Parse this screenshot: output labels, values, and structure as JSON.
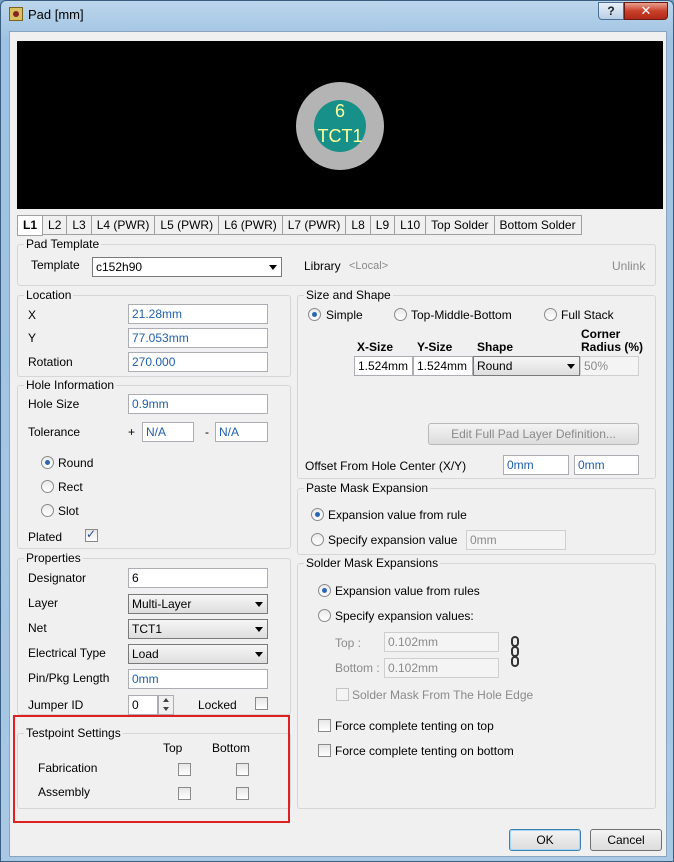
{
  "window": {
    "title": "Pad [mm]",
    "help": "?",
    "close": "✕"
  },
  "preview": {
    "pad_number": "6",
    "pad_net": "TCT1"
  },
  "tabs": [
    "L1",
    "L2",
    "L3",
    "L4 (PWR)",
    "L5 (PWR)",
    "L6 (PWR)",
    "L7 (PWR)",
    "L8",
    "L9",
    "L10",
    "Top Solder",
    "Bottom Solder"
  ],
  "pad_template": {
    "title": "Pad Template",
    "template_label": "Template",
    "template_value": "c152h90",
    "library_label": "Library",
    "library_value": "<Local>",
    "unlink": "Unlink"
  },
  "location": {
    "title": "Location",
    "x_label": "X",
    "x_value": "21.28mm",
    "y_label": "Y",
    "y_value": "77.053mm",
    "rotation_label": "Rotation",
    "rotation_value": "270.000"
  },
  "hole": {
    "title": "Hole Information",
    "size_label": "Hole Size",
    "size_value": "0.9mm",
    "tolerance_label": "Tolerance",
    "tol_plus": "+",
    "tol_plus_value": "N/A",
    "tol_minus": "-",
    "tol_minus_value": "N/A",
    "round": "Round",
    "rect": "Rect",
    "slot": "Slot",
    "plated": "Plated"
  },
  "properties": {
    "title": "Properties",
    "designator_label": "Designator",
    "designator_value": "6",
    "layer_label": "Layer",
    "layer_value": "Multi-Layer",
    "net_label": "Net",
    "net_value": "TCT1",
    "etype_label": "Electrical Type",
    "etype_value": "Load",
    "pinpkg_label": "Pin/Pkg Length",
    "pinpkg_value": "0mm",
    "jumper_label": "Jumper ID",
    "jumper_value": "0",
    "locked_label": "Locked"
  },
  "testpoint": {
    "title": "Testpoint Settings",
    "top": "Top",
    "bottom": "Bottom",
    "fabrication": "Fabrication",
    "assembly": "Assembly"
  },
  "size_shape": {
    "title": "Size and Shape",
    "simple": "Simple",
    "tmb": "Top-Middle-Bottom",
    "full": "Full Stack",
    "xsize_label": "X-Size",
    "ysize_label": "Y-Size",
    "shape_label": "Shape",
    "corner_label_1": "Corner",
    "corner_label_2": "Radius (%)",
    "xsize_value": "1.524mm",
    "ysize_value": "1.524mm",
    "shape_value": "Round",
    "corner_value": "50%",
    "edit_button": "Edit Full Pad Layer Definition...",
    "offset_label": "Offset From Hole Center (X/Y)",
    "offset_x": "0mm",
    "offset_y": "0mm"
  },
  "paste_mask": {
    "title": "Paste Mask Expansion",
    "from_rule": "Expansion value from rule",
    "specify": "Specify expansion value",
    "value": "0mm"
  },
  "solder_mask": {
    "title": "Solder Mask Expansions",
    "from_rules": "Expansion value from rules",
    "specify": "Specify expansion values:",
    "top_label": "Top :",
    "top_value": "0.102mm",
    "bottom_label": "Bottom :",
    "bottom_value": "0.102mm",
    "from_hole_edge": "Solder Mask From The Hole Edge",
    "tent_top": "Force complete tenting on top",
    "tent_bottom": "Force complete tenting on bottom"
  },
  "buttons": {
    "ok": "OK",
    "cancel": "Cancel"
  }
}
